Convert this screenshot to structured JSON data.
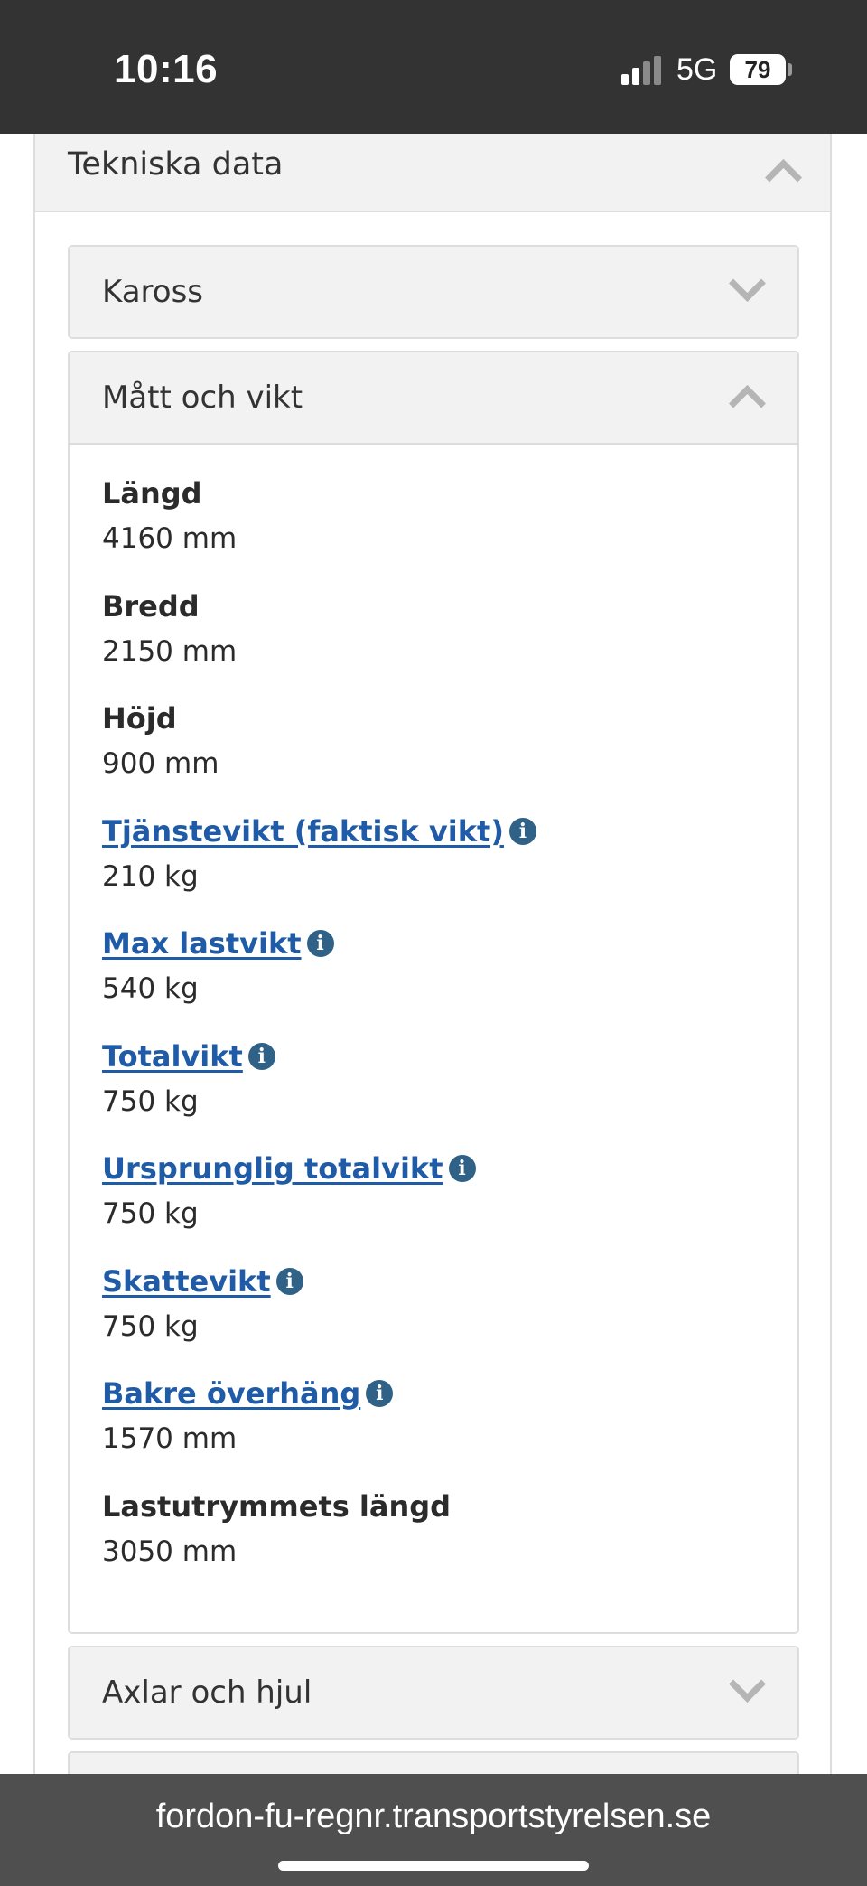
{
  "status_bar": {
    "time": "10:16",
    "network": "5G",
    "battery": "79",
    "icons": [
      "signal-icon",
      "battery-icon"
    ]
  },
  "section": {
    "title": "Tekniska data",
    "expanded": true
  },
  "panels": {
    "kaross": {
      "title": "Kaross",
      "expanded": false
    },
    "matt": {
      "title": "Mått och vikt",
      "expanded": true
    },
    "axlar": {
      "title": "Axlar och hjul",
      "expanded": false
    }
  },
  "fields": [
    {
      "label": "Längd",
      "value": "4160 mm",
      "link": false
    },
    {
      "label": "Bredd",
      "value": "2150 mm",
      "link": false
    },
    {
      "label": "Höjd",
      "value": "900 mm",
      "link": false
    },
    {
      "label": "Tjänstevikt (faktisk vikt) ",
      "value": "210 kg",
      "link": true
    },
    {
      "label": "Max lastvikt ",
      "value": "540 kg",
      "link": true
    },
    {
      "label": "Totalvikt ",
      "value": "750 kg",
      "link": true
    },
    {
      "label": "Ursprunglig totalvikt ",
      "value": "750 kg",
      "link": true
    },
    {
      "label": "Skattevikt ",
      "value": "750 kg",
      "link": true
    },
    {
      "label": "Bakre överhäng ",
      "value": "1570 mm",
      "link": true
    },
    {
      "label": "Lastutrymmets längd",
      "value": "3050 mm",
      "link": false
    }
  ],
  "info_icon_glyph": "i",
  "url_bar": {
    "url": "fordon-fu-regnr.transportstyrelsen.se"
  },
  "colors": {
    "link": "#1f5ba6",
    "info_icon": "#2f6286",
    "panel_header_bg": "#f2f2f2",
    "status_bar_bg": "#333333"
  }
}
